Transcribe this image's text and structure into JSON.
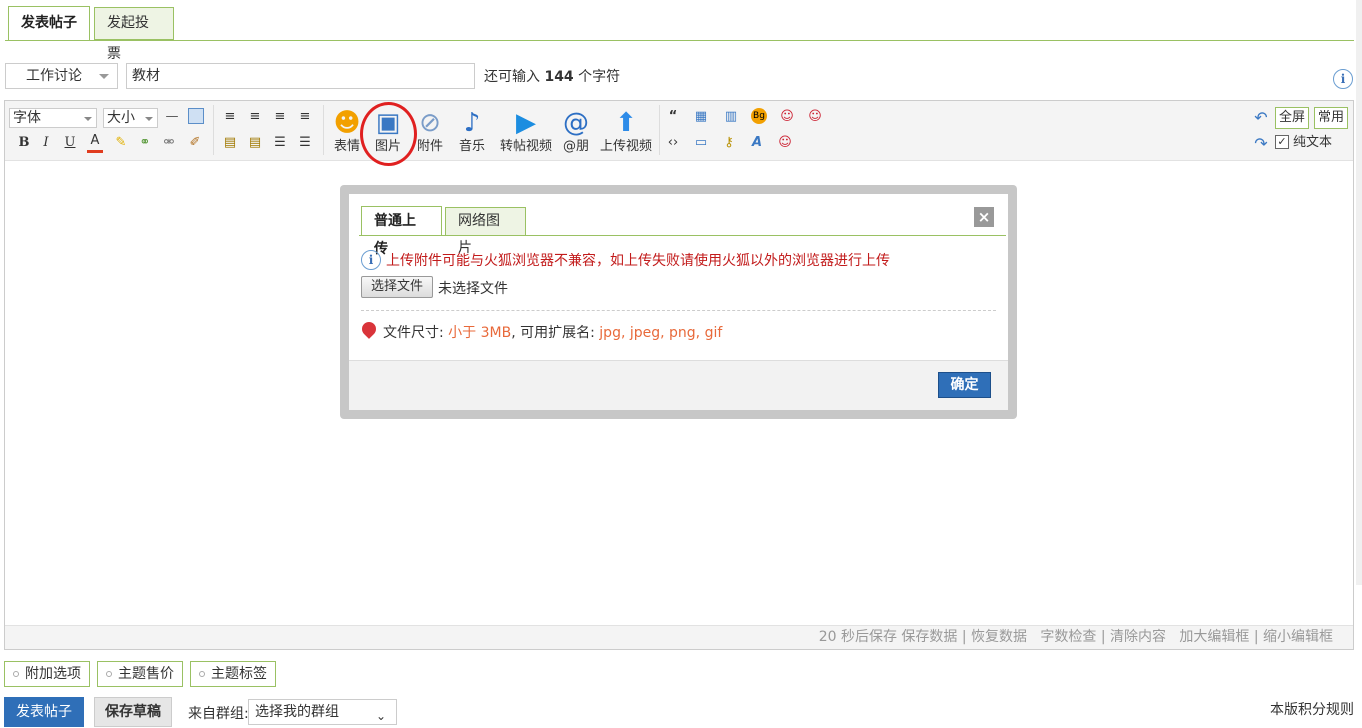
{
  "tabs": [
    {
      "label": "发表帖子"
    },
    {
      "label": "发起投票"
    }
  ],
  "title_row": {
    "category": "工作讨论",
    "title_value": "教材",
    "remain_prefix": "还可输入",
    "remain_count": "144",
    "remain_suffix": "个字符",
    "info": "i"
  },
  "toolbar": {
    "font_select": "字体",
    "size_select": "大小",
    "format_row": [
      "B",
      "I",
      "U",
      "A"
    ],
    "big_buttons": [
      {
        "label": "表情",
        "icon": "smiley-icon"
      },
      {
        "label": "图片",
        "icon": "image-icon"
      },
      {
        "label": "附件",
        "icon": "paperclip-icon"
      },
      {
        "label": "音乐",
        "icon": "music-icon"
      },
      {
        "label": "转帖视频",
        "icon": "video-icon"
      },
      {
        "label": "@朋",
        "icon": "at-icon"
      },
      {
        "label": "上传视频",
        "icon": "upload-icon"
      }
    ],
    "right": {
      "fullscreen": "全屏",
      "common": "常用",
      "plain_text": "纯文本"
    }
  },
  "status_bar": {
    "autosave": "20 秒后保存",
    "save": "保存数据",
    "restore": "恢复数据",
    "count": "字数检查",
    "clear": "清除内容",
    "enlarge": "加大编辑框",
    "shrink": "缩小编辑框"
  },
  "modal": {
    "tabs": [
      {
        "label": "普通上传"
      },
      {
        "label": "网络图片"
      }
    ],
    "close": "×",
    "warning": "上传附件可能与火狐浏览器不兼容，如上传失败请使用火狐以外的浏览器进行上传",
    "choose_file": "选择文件",
    "no_file": "未选择文件",
    "size_label": "文件尺寸:",
    "size_value": "小于 3MB",
    "ext_label": ", 可用扩展名:",
    "ext_value": "jpg, jpeg, png, gif",
    "ok": "确定"
  },
  "bottom": {
    "options": [
      {
        "label": "附加选项"
      },
      {
        "label": "主题售价"
      },
      {
        "label": "主题标签"
      }
    ],
    "post": "发表帖子",
    "draft": "保存草稿",
    "group_label": "来自群组:",
    "group_select": "选择我的群组",
    "rules": "本版积分规则"
  },
  "colors": {
    "accent_green": "#9ac163",
    "primary_blue": "#2f6fb8",
    "warning_red": "#c21b1b",
    "highlight_circle": "#e02020"
  }
}
